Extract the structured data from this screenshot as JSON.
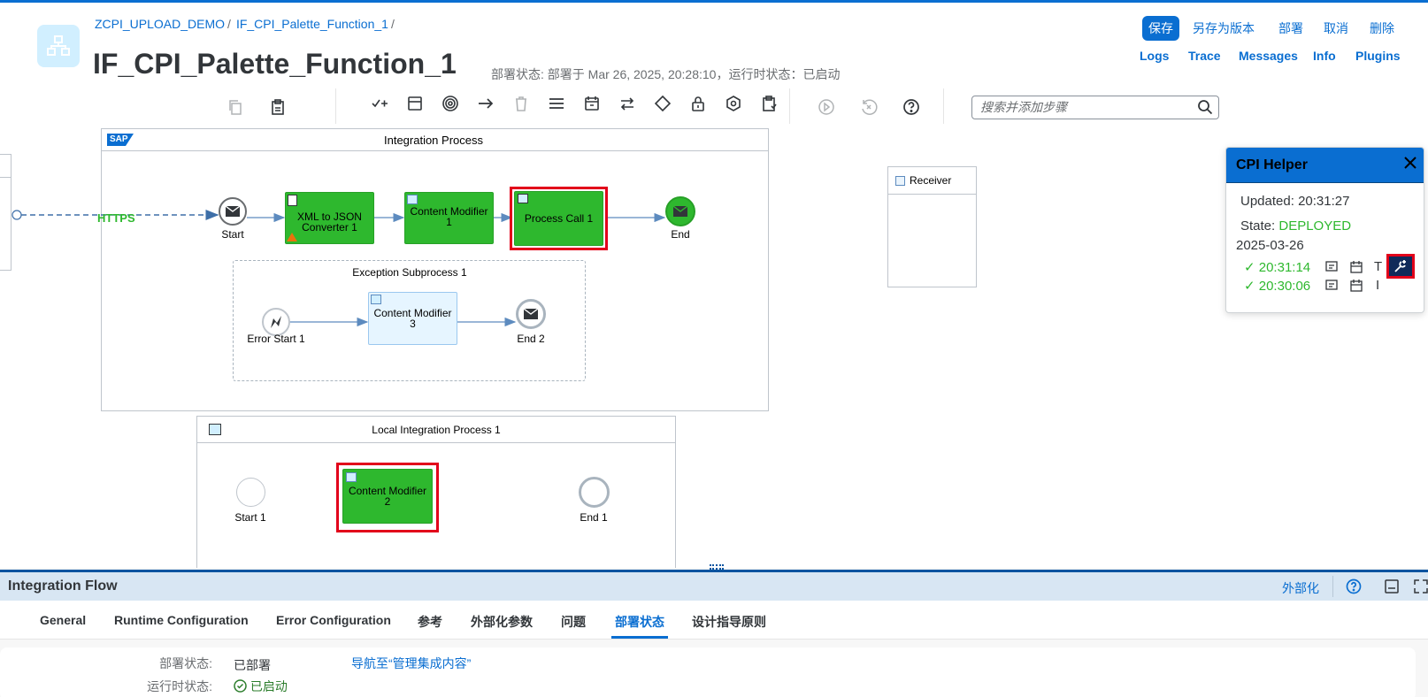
{
  "header": {
    "breadcrumb": [
      "ZCPI_UPLOAD_DEMO",
      "IF_CPI_Palette_Function_1"
    ],
    "breadcrumb_sep": "/",
    "title": "IF_CPI_Palette_Function_1",
    "status_text": "部署状态: 部署于 Mar 26, 2025, 20:28:10，运行时状态：已启动",
    "actions": [
      "保存",
      "另存为版本",
      "部署",
      "取消",
      "删除"
    ],
    "links": [
      "Logs",
      "Trace",
      "Messages",
      "Info",
      "Plugins"
    ]
  },
  "toolbar": {
    "search_placeholder": "搜索并添加步骤",
    "icons": [
      "copy-icon",
      "paste-icon",
      "participants-icon",
      "process-icon",
      "events-icon",
      "connector-icon",
      "delete-icon",
      "menu-icon",
      "call-icon",
      "routing-icon",
      "split-icon",
      "lock-icon",
      "persistence-icon",
      "validator-icon",
      "play-icon",
      "undo-icon",
      "help-icon",
      "search-icon"
    ]
  },
  "canvas": {
    "integration_process_title": "Integration Process",
    "sap_logo": "SAP",
    "https_label": "HTTPS",
    "start_label": "Start",
    "xml_json": "XML to JSON Converter 1",
    "content_modifier_1": "Content Modifier 1",
    "process_call_1": "Process Call 1",
    "end_label": "End",
    "receiver_label": "Receiver",
    "exception_title": "Exception Subprocess 1",
    "error_start": "Error Start 1",
    "content_modifier_3": "Content Modifier 3",
    "end2_label": "End 2",
    "local_title": "Local Integration Process 1",
    "start1_label": "Start 1",
    "content_modifier_2": "Content Modifier 2",
    "end1_label": "End 1"
  },
  "helper": {
    "title": "CPI Helper",
    "updated_label": "Updated:",
    "updated_time": "20:31:27",
    "state_label": "State:",
    "state_value": "DEPLOYED",
    "state_color": "#2b7d2b",
    "date": "2025-03-26",
    "entries": [
      {
        "time": "20:31:14",
        "letter": "T"
      },
      {
        "time": "20:30:06",
        "letter": "I"
      }
    ]
  },
  "bottom": {
    "title": "Integration Flow",
    "externalize": "外部化",
    "tabs": [
      "General",
      "Runtime Configuration",
      "Error Configuration",
      "参考",
      "外部化参数",
      "问题",
      "部署状态",
      "设计指导原则"
    ],
    "selected_tab": "部署状态",
    "deploy_label": "部署状态:",
    "deploy_value": "已部署",
    "nav_link": "导航至“管理集成内容”",
    "runtime_label": "运行时状态:",
    "runtime_value": "已启动"
  },
  "colors": {
    "accent": "#0a6ed1",
    "step_green": "#2eb82e",
    "highlight_red": "#e2001a"
  }
}
